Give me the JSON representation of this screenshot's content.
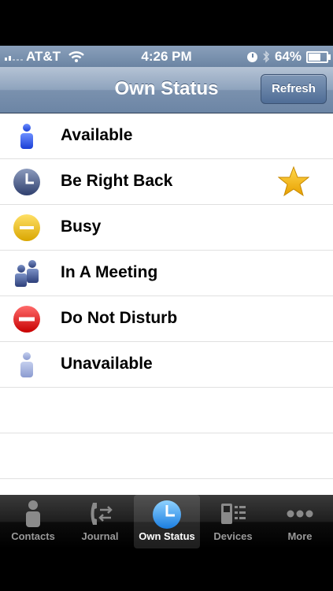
{
  "status_bar": {
    "carrier": "AT&T",
    "time": "4:26 PM",
    "battery": "64%",
    "battery_level": 0.64
  },
  "nav": {
    "title": "Own Status",
    "refresh_label": "Refresh"
  },
  "statuses": [
    {
      "label": "Available",
      "icon": "person-available-icon"
    },
    {
      "label": "Be Right Back",
      "icon": "clock-icon",
      "favorite": true
    },
    {
      "label": "Busy",
      "icon": "busy-icon"
    },
    {
      "label": "In A Meeting",
      "icon": "meeting-icon"
    },
    {
      "label": "Do Not Disturb",
      "icon": "do-not-disturb-icon"
    },
    {
      "label": "Unavailable",
      "icon": "person-unavailable-icon"
    }
  ],
  "tabs": [
    {
      "label": "Contacts",
      "icon": "contacts-icon"
    },
    {
      "label": "Journal",
      "icon": "journal-icon"
    },
    {
      "label": "Own Status",
      "icon": "clock-icon",
      "active": true
    },
    {
      "label": "Devices",
      "icon": "devices-icon"
    },
    {
      "label": "More",
      "icon": "more-icon"
    }
  ]
}
